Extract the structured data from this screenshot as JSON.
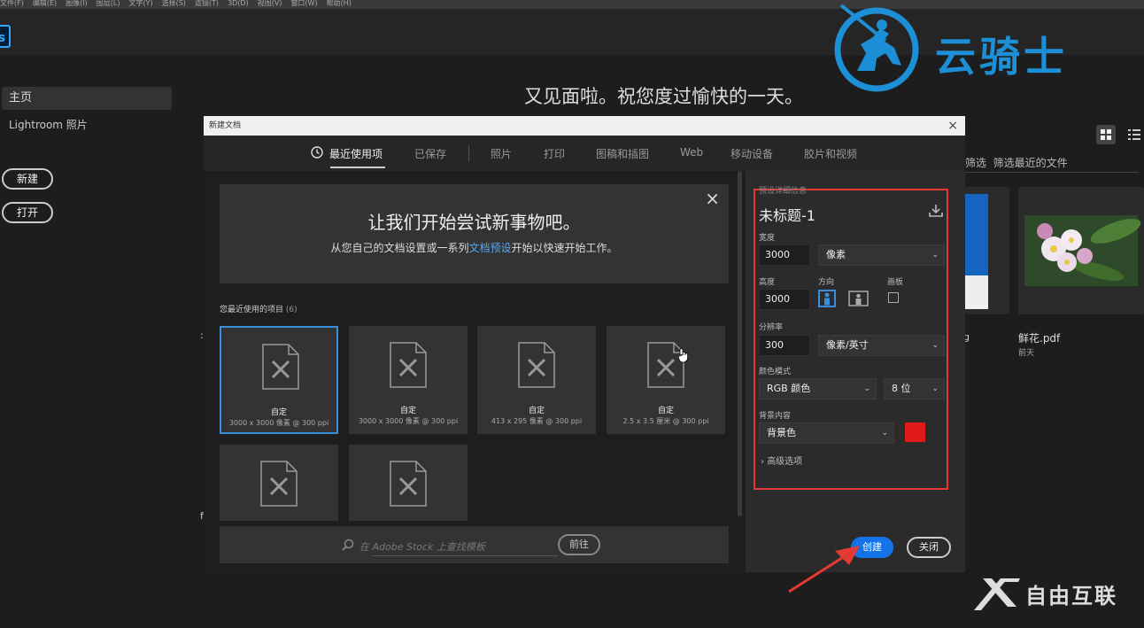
{
  "menubar": [
    "文件(F)",
    "编辑(E)",
    "图像(I)",
    "图层(L)",
    "文字(Y)",
    "选择(S)",
    "滤镜(T)",
    "3D(D)",
    "视图(V)",
    "窗口(W)",
    "帮助(H)"
  ],
  "app": {
    "logo_text": "s"
  },
  "leftnav": {
    "home": "主页",
    "lightroom": "Lightroom 照片",
    "new_btn": "新建",
    "open_btn": "打开"
  },
  "home": {
    "greeting": "又见面啦。祝您度过愉快的一天。",
    "filter_label": "筛选",
    "filter_placeholder": "筛选最近的文件",
    "recent_file_name": "鲜花.pdf",
    "recent_file_date": "前天",
    "partial_g": "g"
  },
  "brand": {
    "name": "云骑士"
  },
  "watermark": {
    "name": "自由互联"
  },
  "dialog": {
    "title": "新建文档",
    "close": "×",
    "tabs": [
      "最近使用项",
      "已保存",
      "照片",
      "打印",
      "图稿和插图",
      "Web",
      "移动设备",
      "胶片和视频"
    ],
    "welcome": {
      "title": "让我们开始尝试新事物吧。",
      "sub_before": "从您自己的文档设置或一系列",
      "sub_link": "文档预设",
      "sub_after": "开始以快速开始工作。",
      "close": "×"
    },
    "recent_label": "您最近使用的项目",
    "recent_count": "(6)",
    "cards": [
      {
        "title": "自定",
        "size": "3000 x 3000 像素 @ 300 ppi"
      },
      {
        "title": "自定",
        "size": "3000 x 3000 像素 @ 300 ppi"
      },
      {
        "title": "自定",
        "size": "413 x 295 像素 @ 300 ppi"
      },
      {
        "title": "自定",
        "size": "2.5 x 3.5 厘米 @ 300 ppi"
      },
      {
        "title": "",
        "size": ""
      },
      {
        "title": "",
        "size": ""
      }
    ],
    "search_placeholder": "在 Adobe Stock 上查找模板",
    "goto_button": "前往",
    "preset": {
      "section_label": "预设详细信息",
      "doc_name": "未标题-1",
      "width_label": "宽度",
      "width_value": "3000",
      "width_unit": "像素",
      "height_label": "高度",
      "height_value": "3000",
      "orientation_label": "方向",
      "artboard_label": "画板",
      "resolution_label": "分辨率",
      "resolution_value": "300",
      "resolution_unit": "像素/英寸",
      "color_mode_label": "颜色模式",
      "color_mode": "RGB 颜色",
      "bit_depth": "8 位",
      "background_label": "背景内容",
      "background_value": "背景色",
      "background_color": "#e11b1b",
      "advanced": "高级选项"
    },
    "create_button": "创建",
    "close_button": "关闭"
  }
}
